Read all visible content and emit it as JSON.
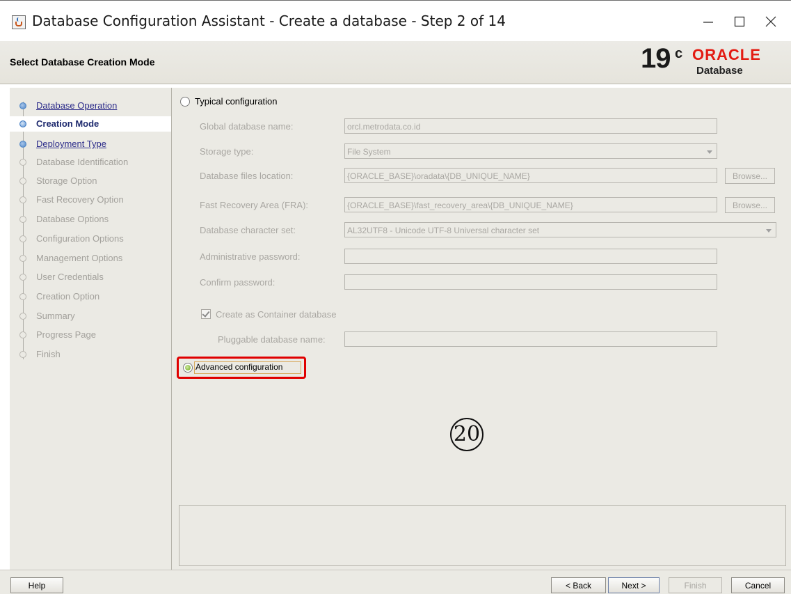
{
  "window": {
    "title": "Database Configuration Assistant - Create a database - Step 2 of 14"
  },
  "header": {
    "page_title": "Select Database Creation Mode",
    "logo_version": "19",
    "logo_superscript": "c",
    "logo_brand": "ORACLE",
    "logo_product": "Database"
  },
  "nav": {
    "items": [
      {
        "label": "Database Operation",
        "state": "done"
      },
      {
        "label": "Creation Mode",
        "state": "current"
      },
      {
        "label": "Deployment Type",
        "state": "done"
      },
      {
        "label": "Database Identification",
        "state": "pending"
      },
      {
        "label": "Storage Option",
        "state": "pending"
      },
      {
        "label": "Fast Recovery Option",
        "state": "pending"
      },
      {
        "label": "Database Options",
        "state": "pending"
      },
      {
        "label": "Configuration Options",
        "state": "pending"
      },
      {
        "label": "Management Options",
        "state": "pending"
      },
      {
        "label": "User Credentials",
        "state": "pending"
      },
      {
        "label": "Creation Option",
        "state": "pending"
      },
      {
        "label": "Summary",
        "state": "pending"
      },
      {
        "label": "Progress Page",
        "state": "pending"
      },
      {
        "label": "Finish",
        "state": "pending"
      }
    ]
  },
  "typical": {
    "radio_label": "Typical configuration",
    "selected": false,
    "global_db_name_label": "Global database name:",
    "global_db_name_value": "orcl.metrodata.co.id",
    "storage_type_label": "Storage type:",
    "storage_type_value": "File System",
    "db_files_location_label": "Database files location:",
    "db_files_location_value": "{ORACLE_BASE}\\oradata\\{DB_UNIQUE_NAME}",
    "fra_label": "Fast Recovery Area (FRA):",
    "fra_value": "{ORACLE_BASE}\\fast_recovery_area\\{DB_UNIQUE_NAME}",
    "charset_label": "Database character set:",
    "charset_value": "AL32UTF8 - Unicode UTF-8 Universal character set",
    "admin_password_label": "Administrative password:",
    "admin_password_value": "",
    "confirm_password_label": "Confirm password:",
    "confirm_password_value": "",
    "container_db_label": "Create as Container database",
    "container_db_checked": true,
    "pdb_name_label": "Pluggable database name:",
    "pdb_name_value": "",
    "browse_label": "Browse..."
  },
  "advanced": {
    "radio_label": "Advanced configuration",
    "selected": true
  },
  "annotation": {
    "step_number": "⑳"
  },
  "buttons": {
    "help": "Help",
    "back": "< Back",
    "next": "Next >",
    "finish": "Finish",
    "cancel": "Cancel"
  },
  "colors": {
    "oracle_red": "#e31b12",
    "highlight_red": "#e00000",
    "panel_bg": "#ebeae4"
  }
}
